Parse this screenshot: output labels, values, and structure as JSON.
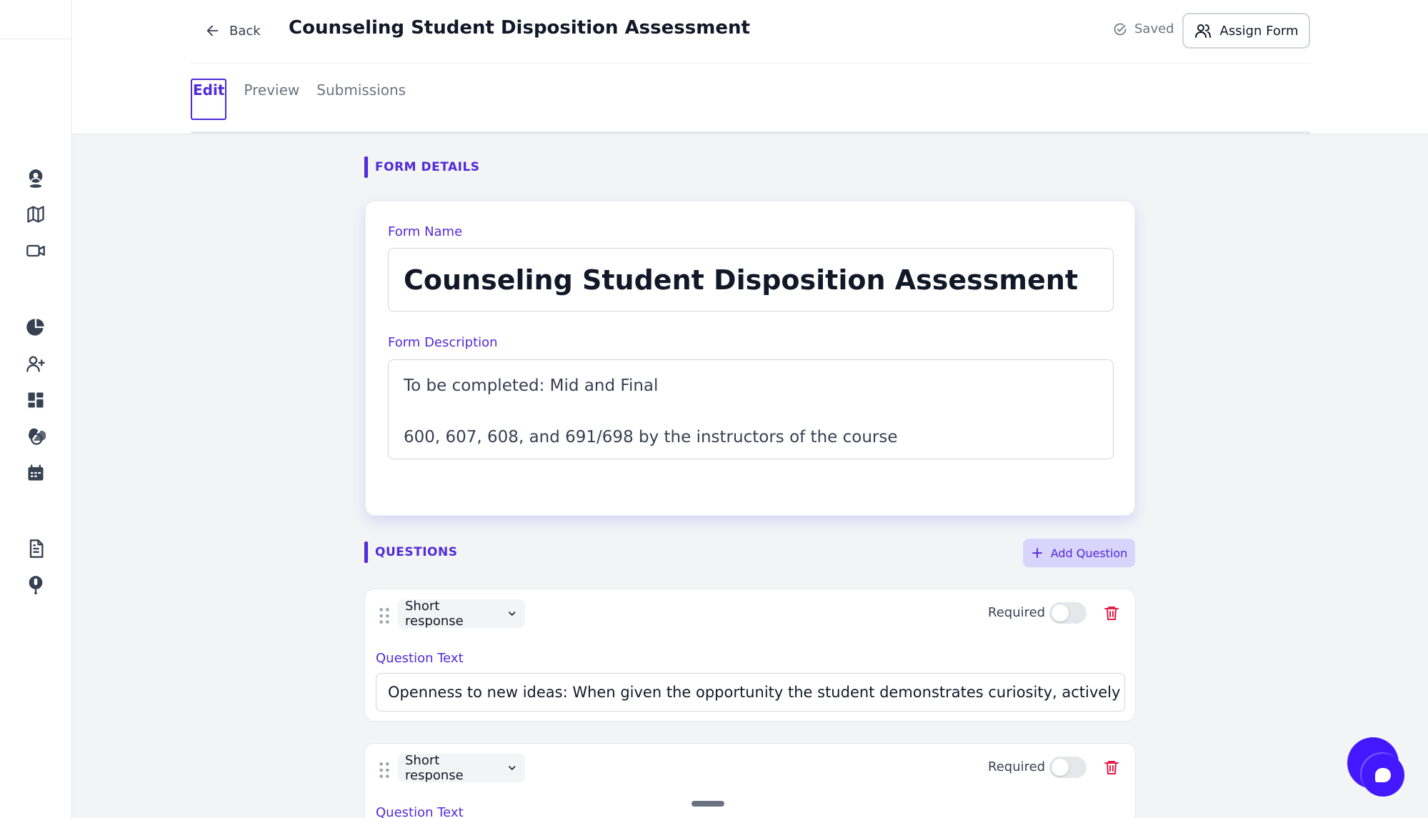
{
  "header": {
    "back_label": "Back",
    "title": "Counseling Student Disposition Assessment",
    "saved_label": "Saved",
    "assign_label": "Assign Form"
  },
  "tabs": [
    {
      "label": "Edit",
      "active": true
    },
    {
      "label": "Preview",
      "active": false
    },
    {
      "label": "Submissions",
      "active": false
    }
  ],
  "sidebar": {
    "icons": [
      "user-pin-icon",
      "map-icon",
      "video-icon",
      "chart-icon",
      "add-user-icon",
      "dashboard-icon",
      "layers-icon",
      "calendar-icon",
      "document-icon",
      "microphone-icon"
    ]
  },
  "form_details": {
    "section_title": "FORM DETAILS",
    "name_label": "Form Name",
    "name_value": "Counseling Student Disposition Assessment",
    "description_label": "Form Description",
    "description_line1": "To be completed: Mid and Final",
    "description_line2": "600, 607, 608, and 691/698 by the instructors of the course"
  },
  "questions": {
    "section_title": "QUESTIONS",
    "add_label": "Add Question",
    "items": [
      {
        "type": "Short response",
        "required_label": "Required",
        "required": false,
        "text_label": "Question Text",
        "text": "Openness to new  ideas: When given the opportunity the student demonstrates curiosity, actively listens, ha"
      },
      {
        "type": "Short response",
        "required_label": "Required",
        "required": false,
        "text_label": "Question Text",
        "text": ""
      }
    ]
  },
  "colors": {
    "accent": "#4f2bd9",
    "chat": "#4318ff",
    "danger": "#e11d48"
  }
}
